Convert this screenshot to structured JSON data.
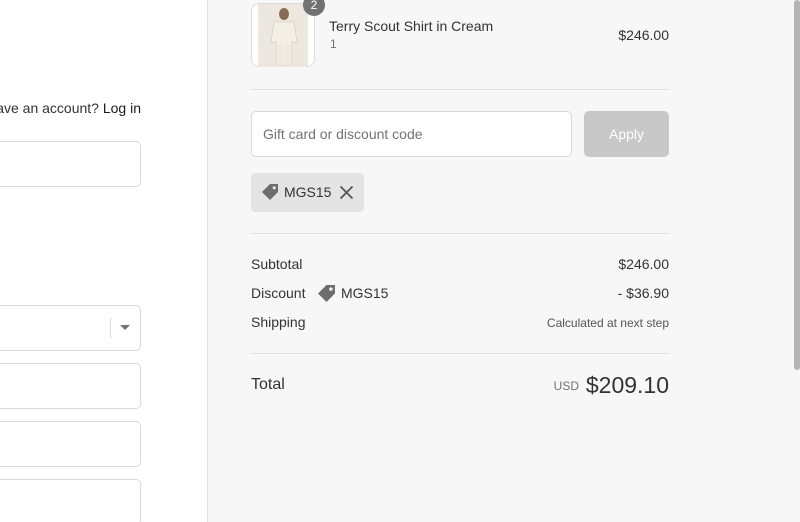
{
  "account": {
    "prompt": "ave an account?",
    "login_label": "Log in"
  },
  "cart": {
    "item": {
      "name": "Terry Scout Shirt in Cream",
      "variant": "1",
      "price": "$246.00",
      "quantity_badge": "2"
    }
  },
  "discount": {
    "placeholder": "Gift card or discount code",
    "value": "",
    "apply_label": "Apply",
    "applied_code": "MGS15"
  },
  "summary": {
    "subtotal_label": "Subtotal",
    "subtotal_value": "$246.00",
    "discount_label": "Discount",
    "discount_code": "MGS15",
    "discount_value": "- $36.90",
    "shipping_label": "Shipping",
    "shipping_value": "Calculated at next step",
    "total_label": "Total",
    "total_currency": "USD",
    "total_value": "$209.10"
  },
  "icons": {
    "chip_tag": "tag-icon",
    "chip_remove": "close-icon",
    "discount_tag": "tag-icon",
    "country_select": "chevron-down-icon"
  },
  "colors": {
    "summary_bg": "#f7f7f7",
    "apply_disabled_bg": "#c8c8c8",
    "chip_bg": "#e4e4e4",
    "badge_bg": "#727272",
    "icon_gray": "#6d6d6d"
  }
}
